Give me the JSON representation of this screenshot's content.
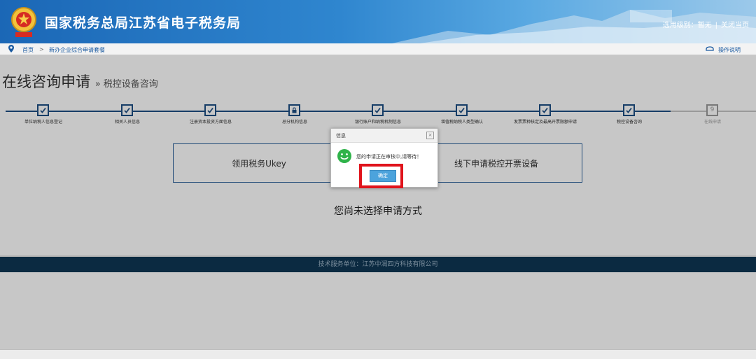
{
  "header": {
    "site_title": "国家税务总局江苏省电子税务局",
    "user_link": "选用级别：暂无",
    "close_link": "关闭当页",
    "separator": "|"
  },
  "breadcrumb": {
    "home": "首页",
    "arrow": ">",
    "current": "新办企业综合申请套餐",
    "help": "操作说明"
  },
  "page": {
    "title": "在线咨询申请",
    "subtitle": "» 税控设备咨询"
  },
  "steps": [
    {
      "label": "单位纳税人信息登记",
      "state": "done"
    },
    {
      "label": "相关人员信息",
      "state": "done"
    },
    {
      "label": "注册资本投资方面信息",
      "state": "done"
    },
    {
      "label": "总分机构信息",
      "state": "current"
    },
    {
      "label": "银行账户和纳税机制信息",
      "state": "done"
    },
    {
      "label": "增值税纳税人类型确认",
      "state": "done"
    },
    {
      "label": "发票票种核定及最高开票限额申请",
      "state": "done"
    },
    {
      "label": "税控设备咨询",
      "state": "done"
    },
    {
      "label": "在线申请",
      "state": "pending",
      "number": "9"
    }
  ],
  "options": {
    "option1": "领用税务Ukey",
    "option2": "线下申请税控开票设备"
  },
  "status_message": "您尚未选择申请方式",
  "footer": "技术服务单位：江苏中润四方科技有限公司",
  "dialog": {
    "title": "信息",
    "close_symbol": "×",
    "message": "您的申请正在审核中,请等待！",
    "ok_button": "确定"
  },
  "colors": {
    "header_blue": "#1b67b6",
    "step_blue": "#1d4f84",
    "footer_navy": "#0f3654",
    "highlight_red": "#e0141c",
    "ok_button_blue": "#4ca3dc",
    "smile_green": "#2fb34a"
  },
  "icons": [
    "emblem-icon",
    "location-pin-icon",
    "help-icon",
    "check-icon",
    "lock-icon",
    "smile-icon",
    "close-icon"
  ]
}
